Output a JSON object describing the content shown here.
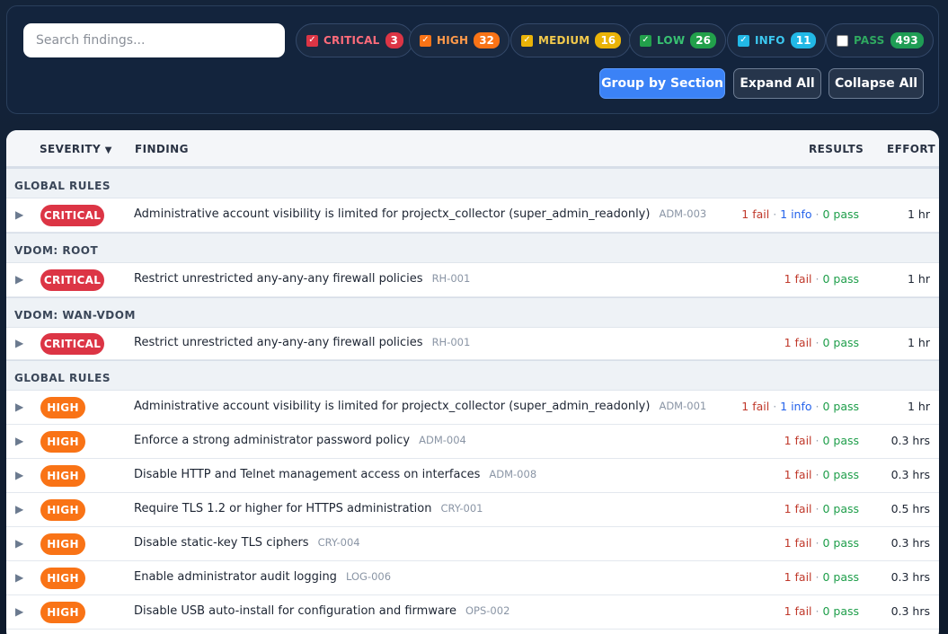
{
  "search": {
    "placeholder": "Search findings..."
  },
  "filters": [
    {
      "label": "CRITICAL",
      "count": "3",
      "checked": true,
      "color": "#dc3545",
      "text_color": "#ff6b7a"
    },
    {
      "label": "HIGH",
      "count": "32",
      "checked": true,
      "color": "#f97316",
      "text_color": "#ff9a4a"
    },
    {
      "label": "MEDIUM",
      "count": "16",
      "checked": true,
      "color": "#eab308",
      "text_color": "#f2c94c"
    },
    {
      "label": "LOW",
      "count": "26",
      "checked": true,
      "color": "#22a04b",
      "text_color": "#38c172"
    },
    {
      "label": "INFO",
      "count": "11",
      "checked": true,
      "color": "#22b8e6",
      "text_color": "#3cc8f0"
    },
    {
      "label": "PASS",
      "count": "493",
      "checked": false,
      "color": "#1f9d55",
      "text_color": "#2fa860"
    }
  ],
  "buttons": {
    "group_by": "Group by Section",
    "expand_all": "Expand All",
    "collapse_all": "Collapse All"
  },
  "columns": {
    "severity": "SEVERITY",
    "severity_sort_icon": "sort-down-icon",
    "finding": "FINDING",
    "results": "RESULTS",
    "effort": "EFFORT"
  },
  "sections": [
    {
      "title": "GLOBAL RULES",
      "rows": [
        {
          "severity": "CRITICAL",
          "finding": "Administrative account visibility is limited for projectx_collector (super_admin_readonly)",
          "id": "ADM-003",
          "fail": "1 fail",
          "info": "1 info",
          "pass": "0 pass",
          "effort": "1 hr"
        }
      ]
    },
    {
      "title": "VDOM: ROOT",
      "rows": [
        {
          "severity": "CRITICAL",
          "finding": "Restrict unrestricted any-any-any firewall policies",
          "id": "RH-001",
          "fail": "1 fail",
          "info": "",
          "pass": "0 pass",
          "effort": "1 hr"
        }
      ]
    },
    {
      "title": "VDOM: WAN-VDOM",
      "rows": [
        {
          "severity": "CRITICAL",
          "finding": "Restrict unrestricted any-any-any firewall policies",
          "id": "RH-001",
          "fail": "1 fail",
          "info": "",
          "pass": "0 pass",
          "effort": "1 hr"
        }
      ]
    },
    {
      "title": "GLOBAL RULES",
      "rows": [
        {
          "severity": "HIGH",
          "finding": "Administrative account visibility is limited for projectx_collector (super_admin_readonly)",
          "id": "ADM-001",
          "fail": "1 fail",
          "info": "1 info",
          "pass": "0 pass",
          "effort": "1 hr"
        },
        {
          "severity": "HIGH",
          "finding": "Enforce a strong administrator password policy",
          "id": "ADM-004",
          "fail": "1 fail",
          "info": "",
          "pass": "0 pass",
          "effort": "0.3 hrs"
        },
        {
          "severity": "HIGH",
          "finding": "Disable HTTP and Telnet management access on interfaces",
          "id": "ADM-008",
          "fail": "1 fail",
          "info": "",
          "pass": "0 pass",
          "effort": "0.3 hrs"
        },
        {
          "severity": "HIGH",
          "finding": "Require TLS 1.2 or higher for HTTPS administration",
          "id": "CRY-001",
          "fail": "1 fail",
          "info": "",
          "pass": "0 pass",
          "effort": "0.5 hrs"
        },
        {
          "severity": "HIGH",
          "finding": "Disable static-key TLS ciphers",
          "id": "CRY-004",
          "fail": "1 fail",
          "info": "",
          "pass": "0 pass",
          "effort": "0.3 hrs"
        },
        {
          "severity": "HIGH",
          "finding": "Enable administrator audit logging",
          "id": "LOG-006",
          "fail": "1 fail",
          "info": "",
          "pass": "0 pass",
          "effort": "0.3 hrs"
        },
        {
          "severity": "HIGH",
          "finding": "Disable USB auto-install for configuration and firmware",
          "id": "OPS-002",
          "fail": "1 fail",
          "info": "",
          "pass": "0 pass",
          "effort": "0.3 hrs"
        }
      ]
    }
  ]
}
